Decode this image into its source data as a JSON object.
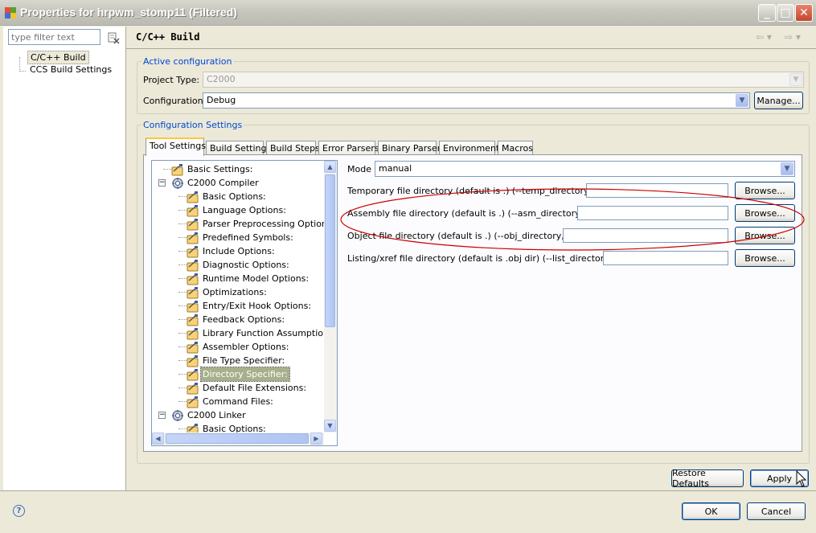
{
  "window": {
    "title": "Properties for hrpwm_stomp11 (Filtered)",
    "controls": {
      "minimize": "_",
      "maximize": "□",
      "close": "✕"
    }
  },
  "sidebar": {
    "filter_placeholder": "type filter text",
    "items": [
      {
        "label": "C/C++ Build",
        "selected": true
      },
      {
        "label": "CCS Build Settings",
        "selected": false
      }
    ]
  },
  "page": {
    "title": "C/C++ Build",
    "nav_back": "⇦ ▾",
    "nav_forward": "⇨ ▾"
  },
  "active_config": {
    "legend": "Active configuration",
    "project_type_label": "Project Type:",
    "project_type_value": "C2000",
    "configuration_label": "Configuration:",
    "configuration_value": "Debug",
    "manage_button": "Manage..."
  },
  "config_settings": {
    "legend": "Configuration Settings",
    "tabs": [
      "Tool Settings",
      "Build Settings",
      "Build Steps",
      "Error Parsers",
      "Binary Parser",
      "Environment",
      "Macros"
    ],
    "active_tab": 0
  },
  "tree": {
    "nodes": [
      {
        "label": "Basic Settings:",
        "level": 0
      },
      {
        "label": "C2000 Compiler",
        "level": 0,
        "expander": "−"
      },
      {
        "label": "Basic Options:",
        "level": 1
      },
      {
        "label": "Language Options:",
        "level": 1
      },
      {
        "label": "Parser Preprocessing Options:",
        "level": 1
      },
      {
        "label": "Predefined Symbols:",
        "level": 1
      },
      {
        "label": "Include Options:",
        "level": 1
      },
      {
        "label": "Diagnostic Options:",
        "level": 1
      },
      {
        "label": "Runtime Model Options:",
        "level": 1
      },
      {
        "label": "Optimizations:",
        "level": 1
      },
      {
        "label": "Entry/Exit Hook Options:",
        "level": 1
      },
      {
        "label": "Feedback Options:",
        "level": 1
      },
      {
        "label": "Library Function Assumptions:",
        "level": 1
      },
      {
        "label": "Assembler Options:",
        "level": 1
      },
      {
        "label": "File Type Specifier:",
        "level": 1
      },
      {
        "label": "Directory Specifier:",
        "level": 1,
        "selected": true
      },
      {
        "label": "Default File Extensions:",
        "level": 1
      },
      {
        "label": "Command Files:",
        "level": 1
      },
      {
        "label": "C2000 Linker",
        "level": 0,
        "expander": "−"
      },
      {
        "label": "Basic Options:",
        "level": 1
      }
    ]
  },
  "options": {
    "mode_label": "Mode",
    "mode_value": "manual",
    "browse_label": "Browse...",
    "rows": [
      {
        "label": "Temporary file directory (default is .) (--temp_directory, -ft)",
        "value": ""
      },
      {
        "label": "Assembly file directory (default is .) (--asm_directory, -fs)",
        "value": ""
      },
      {
        "label": "Object file directory (default is .) (--obj_directory, -fr)",
        "value": ""
      },
      {
        "label": "Listing/xref file directory (default is .obj dir) (--list_directory, -ff)",
        "value": ""
      }
    ]
  },
  "footer": {
    "restore_defaults": "Restore Defaults",
    "apply": "Apply",
    "ok": "OK",
    "cancel": "Cancel",
    "help": "?"
  },
  "colors": {
    "accent_legend": "#0046d5",
    "annotation_ellipse": "#cc0000",
    "selection": "#a6b08a"
  }
}
